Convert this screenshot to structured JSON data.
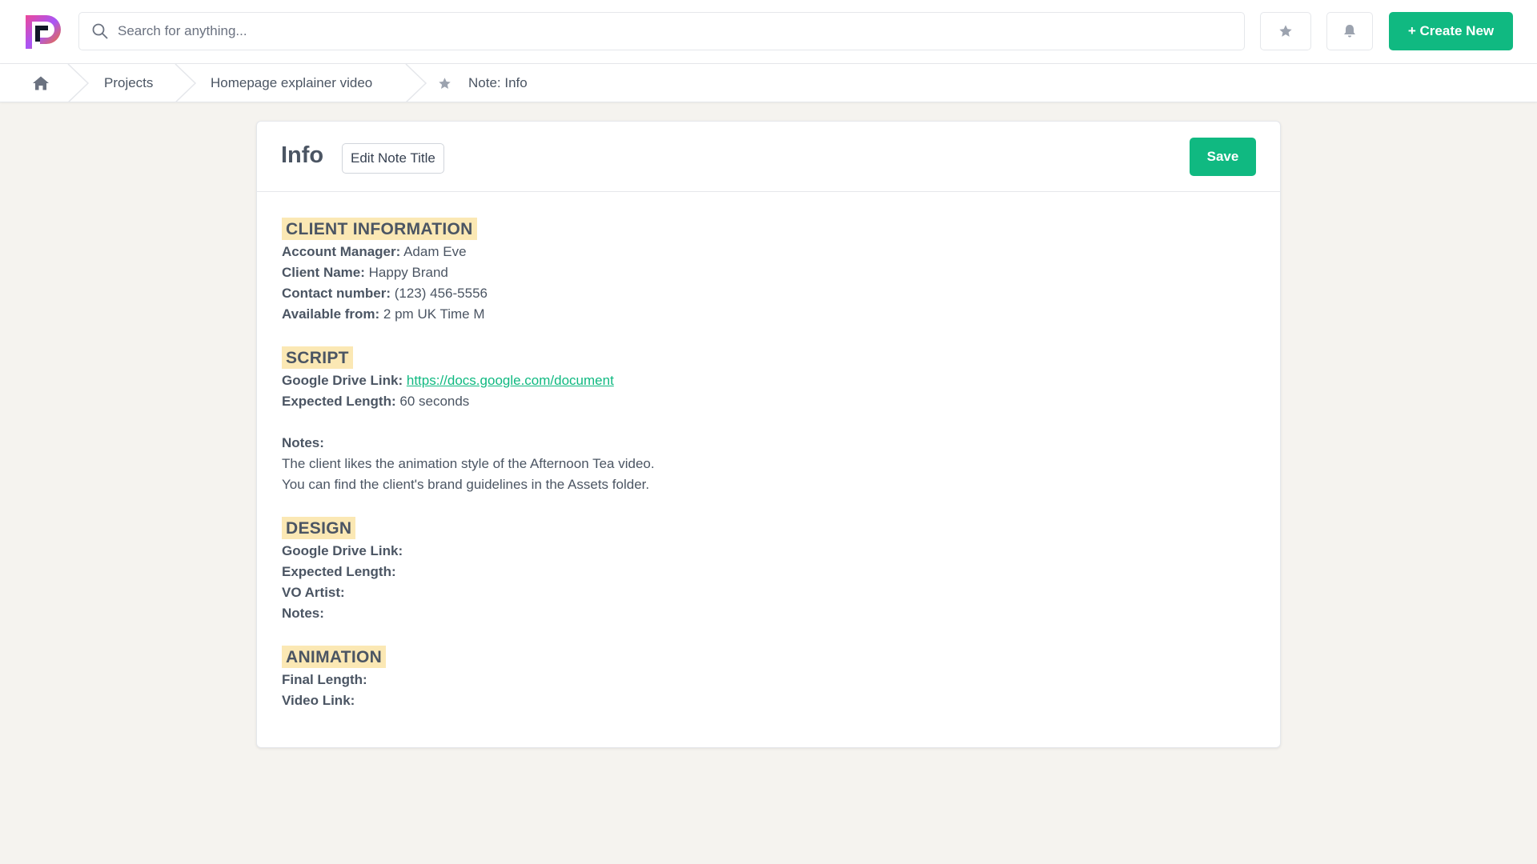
{
  "search": {
    "placeholder": "Search for anything..."
  },
  "header": {
    "create_label": "+ Create New"
  },
  "breadcrumb": {
    "items": [
      "Projects",
      "Homepage explainer video",
      "Note: Info"
    ]
  },
  "note": {
    "title": "Info",
    "edit_title_label": "Edit Note Title",
    "save_label": "Save"
  },
  "sections": {
    "client": {
      "heading": "CLIENT INFORMATION",
      "account_manager_label": "Account Manager:",
      "account_manager_value": "Adam Eve",
      "client_name_label": "Client Name:",
      "client_name_value": "Happy Brand",
      "contact_label": "Contact number:",
      "contact_value": "(123) 456-5556",
      "available_label": "Available from:",
      "available_value": "2 pm UK Time M"
    },
    "script": {
      "heading": "SCRIPT",
      "drive_label": "Google Drive Link:",
      "drive_link": "https://docs.google.com/document",
      "length_label": "Expected Length:",
      "length_value": "60 seconds",
      "notes_label": "Notes:",
      "notes_line1": "The client likes the animation style of the Afternoon Tea video.",
      "notes_line2": "You can find the client's brand guidelines in the Assets folder."
    },
    "design": {
      "heading": "DESIGN",
      "drive_label": "Google Drive Link:",
      "length_label": "Expected Length:",
      "vo_label": "VO Artist:",
      "notes_label": "Notes:"
    },
    "animation": {
      "heading": "ANIMATION",
      "final_length_label": "Final Length:",
      "video_link_label": "Video Link:"
    }
  },
  "icons": {
    "logo": "app-logo",
    "search": "search-icon",
    "favorites": "star-icon",
    "notifications": "bell-icon",
    "home": "home-icon",
    "favorite_note": "star-icon"
  },
  "colors": {
    "accent": "#10b981",
    "heading_highlight": "#fbe8b4",
    "background": "#f5f3ef"
  }
}
